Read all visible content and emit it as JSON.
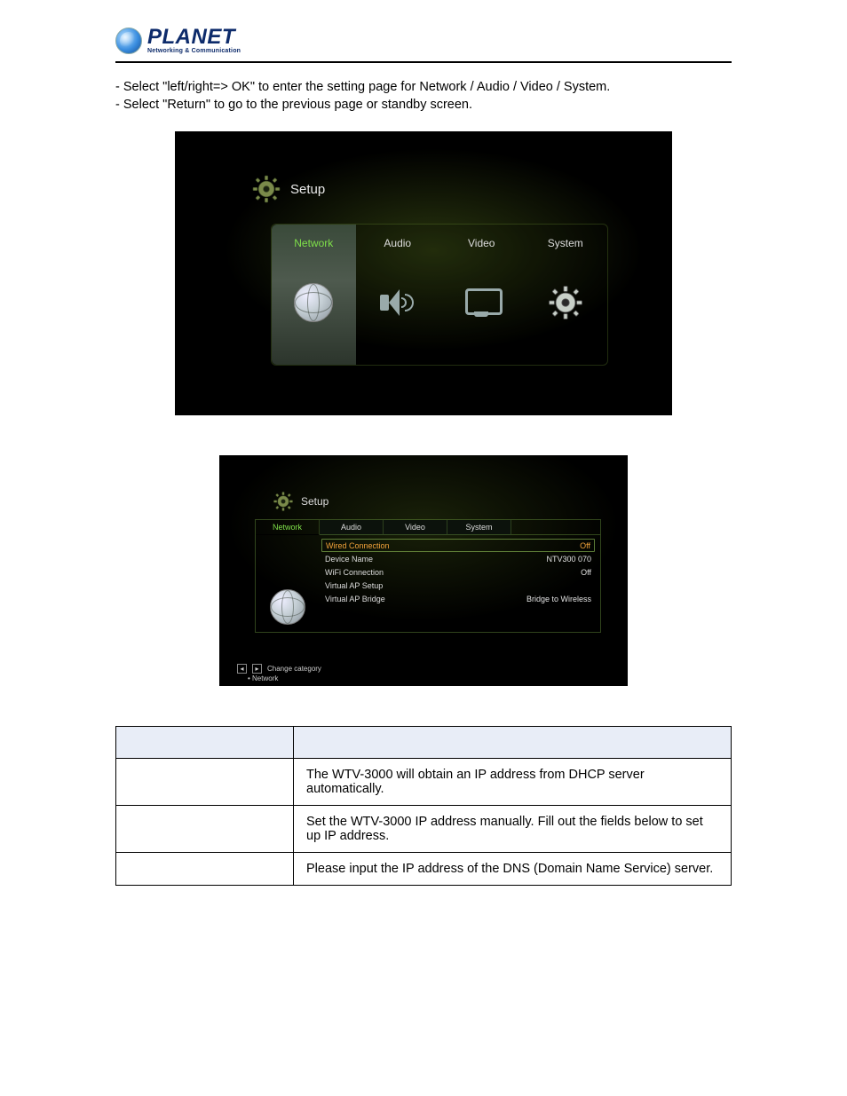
{
  "logo": {
    "name": "PLANET",
    "tagline": "Networking & Communication"
  },
  "instructions": {
    "line1": "- Select \"left/right=> OK\" to enter the setting page for Network / Audio / Video / System.",
    "line2": "- Select \"Return\" to go to the previous page or standby screen."
  },
  "screenshot1": {
    "title": "Setup",
    "menu": [
      {
        "label": "Network",
        "selected": true
      },
      {
        "label": "Audio",
        "selected": false
      },
      {
        "label": "Video",
        "selected": false
      },
      {
        "label": "System",
        "selected": false
      }
    ]
  },
  "screenshot2": {
    "title": "Setup",
    "tabs": [
      {
        "label": "Network",
        "active": true
      },
      {
        "label": "Audio",
        "active": false
      },
      {
        "label": "Video",
        "active": false
      },
      {
        "label": "System",
        "active": false
      }
    ],
    "rows": [
      {
        "name": "Wired Connection",
        "value": "Off",
        "highlight": true
      },
      {
        "name": "Device Name",
        "value": "NTV300 070"
      },
      {
        "name": "WiFi Connection",
        "value": "Off"
      },
      {
        "name": "Virtual AP Setup",
        "value": ""
      },
      {
        "name": "Virtual AP Bridge",
        "value": "Bridge to Wireless"
      }
    ],
    "footer_hint": "Change category",
    "footer_sub": "Network"
  },
  "table": {
    "rows": [
      {
        "label": "",
        "desc": "The WTV-3000 will obtain an IP address from DHCP server automatically."
      },
      {
        "label": "",
        "desc": "Set the WTV-3000 IP address manually. Fill out the fields below to set up IP address."
      },
      {
        "label": "",
        "desc": "Please input the IP address of the DNS (Domain Name Service) server."
      }
    ]
  }
}
